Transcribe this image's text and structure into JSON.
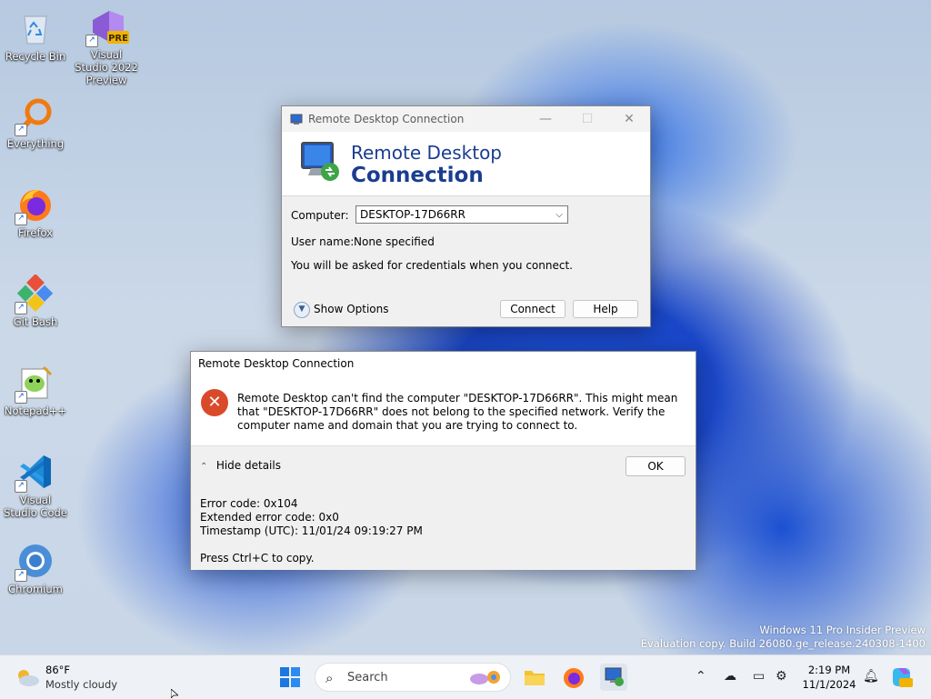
{
  "desktop": {
    "icons": [
      {
        "label": "Recycle Bin",
        "icon": "recycle-bin-icon"
      },
      {
        "label": "Visual Studio 2022 Preview",
        "icon": "visual-studio-icon",
        "badge": "PRE"
      },
      {
        "label": "Everything",
        "icon": "everything-search-icon"
      },
      {
        "label": "Firefox",
        "icon": "firefox-icon"
      },
      {
        "label": "Git Bash",
        "icon": "git-bash-icon"
      },
      {
        "label": "Notepad++",
        "icon": "notepad-plus-plus-icon"
      },
      {
        "label": "Visual Studio Code",
        "icon": "vscode-icon"
      },
      {
        "label": "Chromium",
        "icon": "chromium-icon"
      }
    ],
    "watermark_line1": "Windows 11 Pro Insider Preview",
    "watermark_line2": "Evaluation copy. Build 26080.ge_release.240308-1400"
  },
  "rdc_window": {
    "title": "Remote Desktop Connection",
    "banner_line1": "Remote Desktop",
    "banner_line2": "Connection",
    "computer_label": "Computer:",
    "computer_value": "DESKTOP-17D66RR",
    "username_label": "User name:",
    "username_value": "None specified",
    "credentials_note": "You will be asked for credentials when you connect.",
    "show_options": "Show Options",
    "connect_button": "Connect",
    "help_button": "Help",
    "minimize": "—",
    "maximize": "☐",
    "close": "✕"
  },
  "error_dialog": {
    "title": "Remote Desktop Connection",
    "message": "Remote Desktop can't find the computer \"DESKTOP-17D66RR\". This might mean that \"DESKTOP-17D66RR\" does not belong to the specified network.  Verify the computer name and domain that you are trying to connect to.",
    "hide_details": "Hide details",
    "ok_button": "OK",
    "error_code": "Error code: 0x104",
    "extended_error_code": "Extended error code: 0x0",
    "timestamp": "Timestamp (UTC): 11/01/24 09:19:27 PM",
    "copy_hint": "Press Ctrl+C to copy."
  },
  "taskbar": {
    "weather_temp": "86°F",
    "weather_condition": "Mostly cloudy",
    "search_placeholder": "Search",
    "time": "2:19 PM",
    "date": "11/1/2024",
    "pinned_apps": [
      "start-icon",
      "file-explorer-icon",
      "firefox-icon",
      "remote-desktop-icon"
    ],
    "tray_icons": [
      "chevron-up-icon",
      "onedrive-icon",
      "display-icon",
      "network-icon",
      "notification-icon",
      "copilot-icon"
    ]
  },
  "colors": {
    "banner_text": "#1a3d8f",
    "error_icon": "#d94a2b",
    "wallpaper_blue": "#1a47c8"
  }
}
